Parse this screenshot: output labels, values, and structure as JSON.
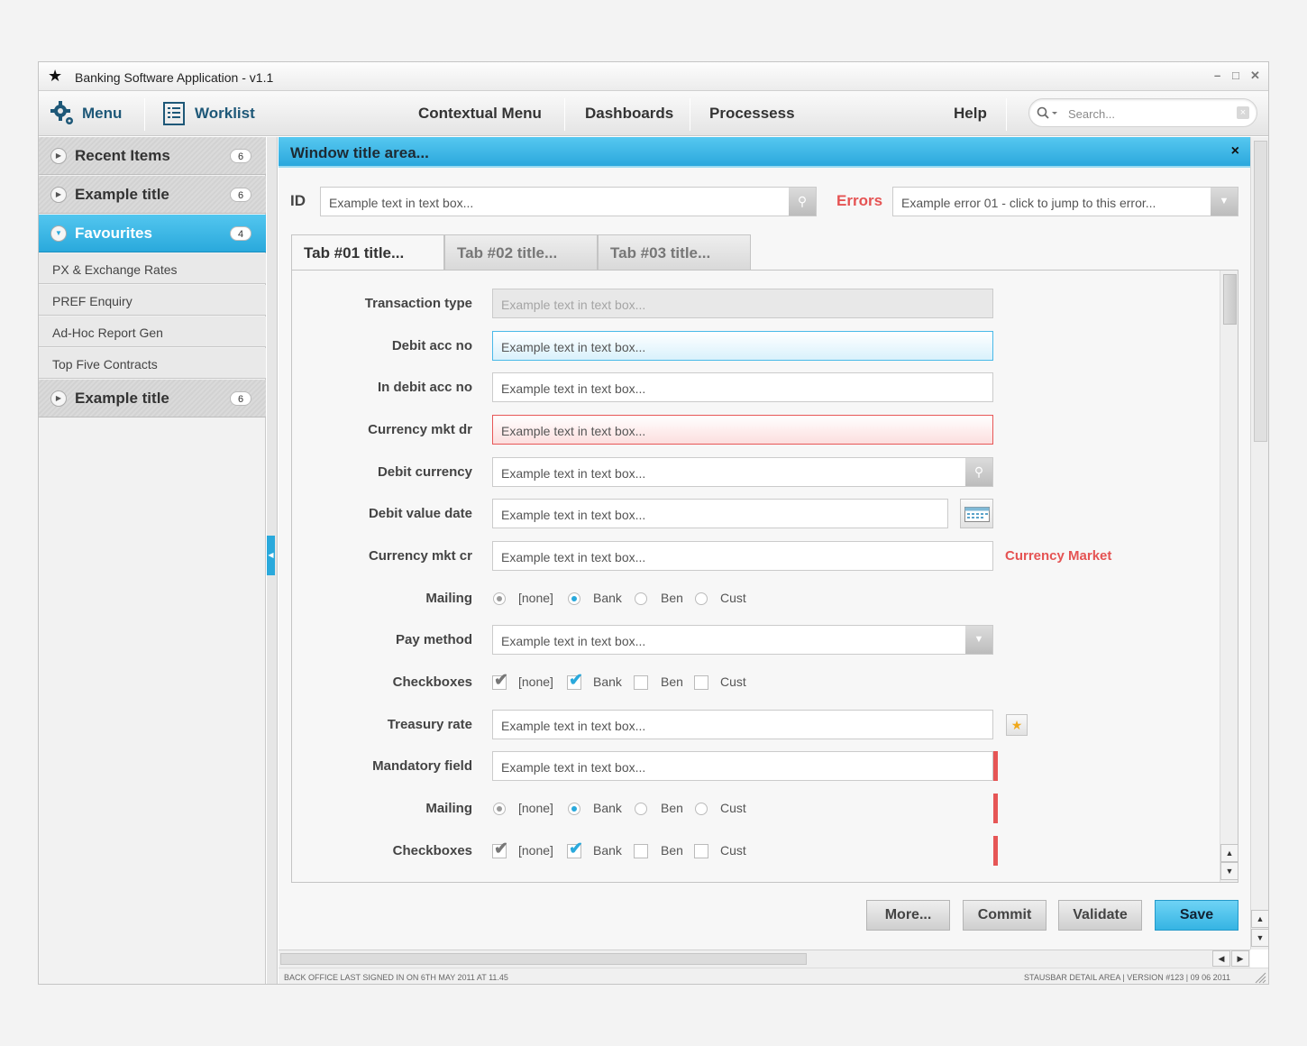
{
  "window": {
    "title": "Banking Software Application - v1.1",
    "minimize": "–",
    "maximize": "□",
    "close": "✕"
  },
  "nav": {
    "menu_label": "Menu",
    "worklist_label": "Worklist",
    "items": [
      "Contextual Menu",
      "Dashboards",
      "Processess",
      "Help"
    ],
    "search_placeholder": "Search..."
  },
  "sidebar": {
    "sections": [
      {
        "label": "Recent Items",
        "count": "6",
        "expanded": false
      },
      {
        "label": "Example title",
        "count": "6",
        "expanded": false
      },
      {
        "label": "Favourites",
        "count": "4",
        "expanded": true
      },
      {
        "label": "Example title",
        "count": "6",
        "expanded": false
      }
    ],
    "favourites": [
      "PX & Exchange Rates",
      "PREF Enquiry",
      "Ad-Hoc Report Gen",
      "Top Five Contracts"
    ]
  },
  "panel": {
    "title": "Window title area...",
    "close": "×",
    "id_label": "ID",
    "id_value": "Example text in text box...",
    "errors_label": "Errors",
    "error_value": "Example error 01 - click to jump to this error...",
    "tabs": [
      "Tab #01 title...",
      "Tab #02 title...",
      "Tab #03 title..."
    ]
  },
  "form": {
    "placeholder": "Example text in text box...",
    "labels": {
      "transaction_type": "Transaction type",
      "debit_acc_no": "Debit acc no",
      "in_debit_acc_no": "In debit acc no",
      "currency_mkt_dr": "Currency mkt dr",
      "debit_currency": "Debit currency",
      "debit_value_date": "Debit value date",
      "currency_mkt_cr": "Currency mkt cr",
      "mailing": "Mailing",
      "pay_method": "Pay method",
      "checkboxes": "Checkboxes",
      "treasury_rate": "Treasury rate",
      "mandatory_field": "Mandatory field"
    },
    "currency_market_note": "Currency Market",
    "options": [
      "[none]",
      "Bank",
      "Ben",
      "Cust"
    ]
  },
  "buttons": {
    "more": "More...",
    "commit": "Commit",
    "validate": "Validate",
    "save": "Save"
  },
  "status": {
    "left": "BACK OFFICE LAST SIGNED IN ON 6TH MAY 2011 AT 11.45",
    "right": "STAUSBAR DETAIL AREA | VERSION #123 | 09 06 2011"
  },
  "colors": {
    "accent": "#2aa9dc",
    "error": "#e55353",
    "mandatory": "#e65656"
  }
}
